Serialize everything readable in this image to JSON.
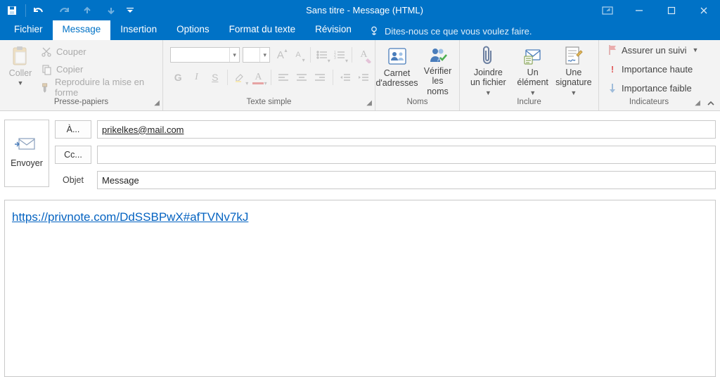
{
  "title": "Sans titre - Message (HTML)",
  "tabs": {
    "fichier": "Fichier",
    "message": "Message",
    "insertion": "Insertion",
    "options": "Options",
    "format": "Format du texte",
    "revision": "Révision"
  },
  "tell_me": "Dites-nous ce que vous voulez faire.",
  "ribbon": {
    "clipboard": {
      "paste": "Coller",
      "cut": "Couper",
      "copy": "Copier",
      "painter": "Reproduire la mise en forme",
      "label": "Presse-papiers"
    },
    "basic_text": {
      "label": "Texte simple",
      "font_name": "",
      "font_size": "",
      "bold": "G",
      "italic": "I",
      "underline": "S",
      "grow": "A",
      "shrink": "A"
    },
    "names": {
      "address_book": "Carnet d'adresses",
      "check_names": "Vérifier les noms",
      "label": "Noms"
    },
    "include": {
      "attach_file": "Joindre un fichier",
      "attach_item": "Un élément",
      "signature": "Une signature",
      "label": "Inclure"
    },
    "tags": {
      "follow_up": "Assurer un suivi",
      "high": "Importance haute",
      "low": "Importance faible",
      "label": "Indicateurs"
    }
  },
  "compose": {
    "send": "Envoyer",
    "to_btn": "À...",
    "cc_btn": "Cc...",
    "subject_label": "Objet",
    "to_value": "prikelkes@mail.com",
    "cc_value": "",
    "subject_value": "Message"
  },
  "body": {
    "link_text": "https://privnote.com/DdSSBPwX#afTVNv7kJ",
    "link_href": "https://privnote.com/DdSSBPwX#afTVNv7kJ"
  }
}
